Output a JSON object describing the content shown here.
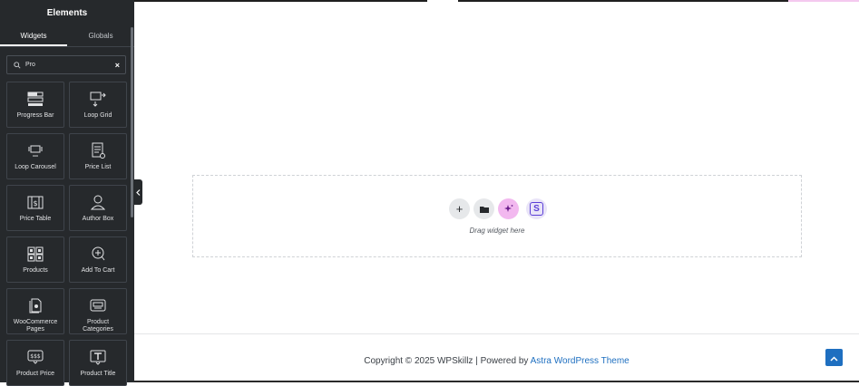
{
  "panel": {
    "title": "Elements",
    "tabs": [
      {
        "label": "Widgets",
        "active": true
      },
      {
        "label": "Globals",
        "active": false
      }
    ],
    "search": {
      "value": "Pro",
      "clear_label": "×"
    }
  },
  "widgets": [
    {
      "label": "Progress Bar",
      "icon": "progress-bar-icon"
    },
    {
      "label": "Loop Grid",
      "icon": "loop-grid-icon"
    },
    {
      "label": "Loop Carousel",
      "icon": "loop-carousel-icon"
    },
    {
      "label": "Price List",
      "icon": "price-list-icon"
    },
    {
      "label": "Price Table",
      "icon": "price-table-icon"
    },
    {
      "label": "Author Box",
      "icon": "author-box-icon"
    },
    {
      "label": "Products",
      "icon": "products-icon"
    },
    {
      "label": "Add To Cart",
      "icon": "add-to-cart-icon"
    },
    {
      "label": "WooCommerce Pages",
      "icon": "woocommerce-pages-icon"
    },
    {
      "label": "Product Categories",
      "icon": "product-categories-icon"
    },
    {
      "label": "Product Price",
      "icon": "product-price-icon"
    },
    {
      "label": "Product Title",
      "icon": "product-title-icon"
    }
  ],
  "canvas": {
    "drop_text": "Drag widget here",
    "add_symbol": "+",
    "s_letter": "S"
  },
  "footer": {
    "copyright": "Copyright © 2025 WPSkillz | Powered by ",
    "link_text": "Astra WordPress Theme"
  },
  "colors": {
    "panel_bg": "#26292c",
    "accent_pink": "#f2b8ef",
    "link_blue": "#1e6fc0"
  }
}
